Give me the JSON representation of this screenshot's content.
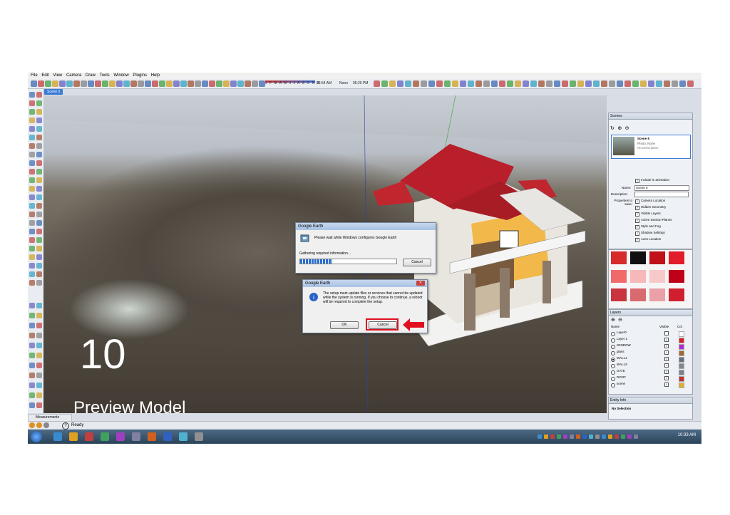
{
  "app": {
    "menu": [
      "File",
      "Edit",
      "View",
      "Camera",
      "Draw",
      "Tools",
      "Window",
      "Plugins",
      "Help"
    ],
    "shadow_months": "J F M A M J J A S O N D",
    "time_start": "06:54 AM",
    "time_noon": "Noon",
    "time_end": "05:20 PM",
    "scene_tab": "Scene 5"
  },
  "overlay": {
    "step_number": "10",
    "caption": "Preview Model"
  },
  "dialog_configure": {
    "title": "Google Earth",
    "message": "Please wait while Windows configures Google Earth",
    "status": "Gathering required information...",
    "progress": 0.33,
    "cancel_label": "Cancel"
  },
  "dialog_update": {
    "title": "Google Earth",
    "message": "The setup must update files or services that cannot be updated while the system is running. If you choose to continue, a reboot will be required to complete the setup.",
    "ok_label": "OK",
    "cancel_label": "Cancel"
  },
  "scenes_panel": {
    "title": "Scenes",
    "scene_name": "Scene 5",
    "photo": "Photo: None",
    "description_text": "No Description",
    "include_animation": "Include in animation",
    "name_label": "Name:",
    "name_value": "Scene 5",
    "description_label": "Description:",
    "properties_label": "Properties to save:",
    "properties": [
      "Camera Location",
      "Hidden Geometry",
      "Visible Layers",
      "Active Section Planes",
      "Style and Fog",
      "Shadow Settings",
      "Axes Location"
    ]
  },
  "colors_panel": {
    "swatches": [
      "#d72a2a",
      "#111111",
      "#c0111a",
      "#e21c2a",
      "#f06a6a",
      "#f6b8b8",
      "#f7c9c9",
      "#c00018",
      "#c9343f",
      "#d86a70",
      "#e9a0a6",
      "#d02030"
    ]
  },
  "layers_panel": {
    "title": "Layers",
    "col_name": "Name",
    "col_visible": "Visible",
    "col_color": "Col",
    "layers": [
      {
        "name": "Layer0",
        "visible": false,
        "active": false,
        "color": "#ffffff"
      },
      {
        "name": "Layer 1",
        "visible": true,
        "active": false,
        "color": "#d42020"
      },
      {
        "name": "WINDOW",
        "visible": true,
        "active": false,
        "color": "#b02ad0"
      },
      {
        "name": "glass",
        "visible": true,
        "active": false,
        "color": "#a06a30"
      },
      {
        "name": "WALL1",
        "visible": true,
        "active": true,
        "color": "#6a7080"
      },
      {
        "name": "WALLS",
        "visible": true,
        "active": false,
        "color": "#808890"
      },
      {
        "name": "GATE",
        "visible": true,
        "active": false,
        "color": "#7a8090"
      },
      {
        "name": "ROOF",
        "visible": true,
        "active": false,
        "color": "#c03030"
      },
      {
        "name": "scene",
        "visible": true,
        "active": false,
        "color": "#e0b030"
      }
    ]
  },
  "entity_panel": {
    "title": "Entity Info",
    "selection": "No Selection"
  },
  "status": {
    "measurements_label": "Measurements",
    "ready": "Ready",
    "clock": "10:33 AM"
  }
}
